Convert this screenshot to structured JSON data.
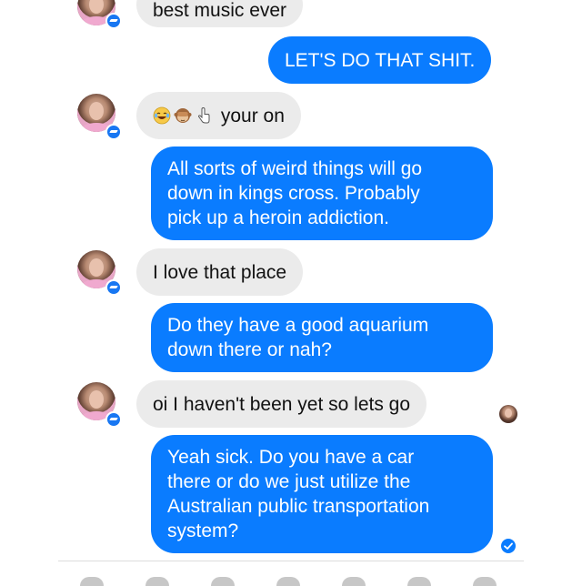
{
  "messages": [
    {
      "id": "m1",
      "direction": "incoming",
      "text": "best music ever"
    },
    {
      "id": "m2",
      "direction": "outgoing",
      "text": "LET'S DO THAT SHIT."
    },
    {
      "id": "m3",
      "direction": "incoming",
      "text": "your on",
      "emojis": [
        "laughing-tears-emoji",
        "see-no-evil-monkey-emoji",
        "pointing-hand-emoji"
      ]
    },
    {
      "id": "m4",
      "direction": "outgoing",
      "lines": [
        "All sorts of weird things will go",
        "down in kings cross. Probably",
        "pick up a heroin addiction."
      ]
    },
    {
      "id": "m5",
      "direction": "incoming",
      "text": "I love that place"
    },
    {
      "id": "m6",
      "direction": "outgoing",
      "lines": [
        "Do they have a good aquarium",
        "down there or nah?"
      ]
    },
    {
      "id": "m7",
      "direction": "incoming",
      "text": "oi I haven't been yet so lets go"
    },
    {
      "id": "m8",
      "direction": "outgoing",
      "lines": [
        "Yeah sick. Do you have a car",
        "there or do we just utilize the",
        "Australian public transportation",
        "system?"
      ]
    }
  ],
  "colors": {
    "outgoing_bubble": "#0a7cff",
    "incoming_bubble": "#ebebeb",
    "messenger_badge": "#1877f2"
  },
  "icons": {
    "messenger_badge": "messenger-badge-icon",
    "read_receipt": "read-receipt-avatar",
    "delivered": "delivered-check-icon"
  }
}
